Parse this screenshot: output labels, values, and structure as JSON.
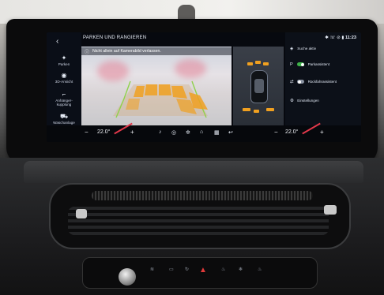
{
  "screen": {
    "header": {
      "title": "PARKEN UND RANGIEREN",
      "back_icon": "chevron-left-icon"
    },
    "warning": {
      "icon": "info-icon",
      "text": "Nicht allein auf Kamerabild verlassen."
    },
    "sidebar": {
      "items": [
        {
          "icon": "parking-sensor-icon",
          "label": "Parken"
        },
        {
          "icon": "3d-view-icon",
          "label": "3D-Ansicht"
        },
        {
          "icon": "trailer-hitch-icon",
          "label": "Anhänger-\nkupplung"
        },
        {
          "icon": "car-wash-icon",
          "label": "Waschanlage"
        }
      ]
    },
    "status_bar": {
      "icons": [
        "bluetooth-icon",
        "phone-icon",
        "mic-off-icon",
        "signal-icon"
      ],
      "time": "11:23"
    },
    "right_panel": {
      "search": {
        "icon": "parking-search-icon",
        "label": "Suche aktiv"
      },
      "toggles": [
        {
          "label": "Parkassistent",
          "on": true,
          "icon": "parking-assist-icon"
        },
        {
          "label": "Rückfahrassistent",
          "on": false,
          "icon": "reverse-assist-icon"
        }
      ],
      "settings": {
        "icon": "gear-icon",
        "label": "Einstellungen"
      }
    },
    "bottom_bar": {
      "left_temp": "22.0°",
      "right_temp": "22.0°",
      "minus": "−",
      "plus": "+"
    },
    "colors": {
      "sensor_orange": "#f0a020",
      "toggle_on": "#3fb24a",
      "slash_red": "#e0384a"
    }
  }
}
